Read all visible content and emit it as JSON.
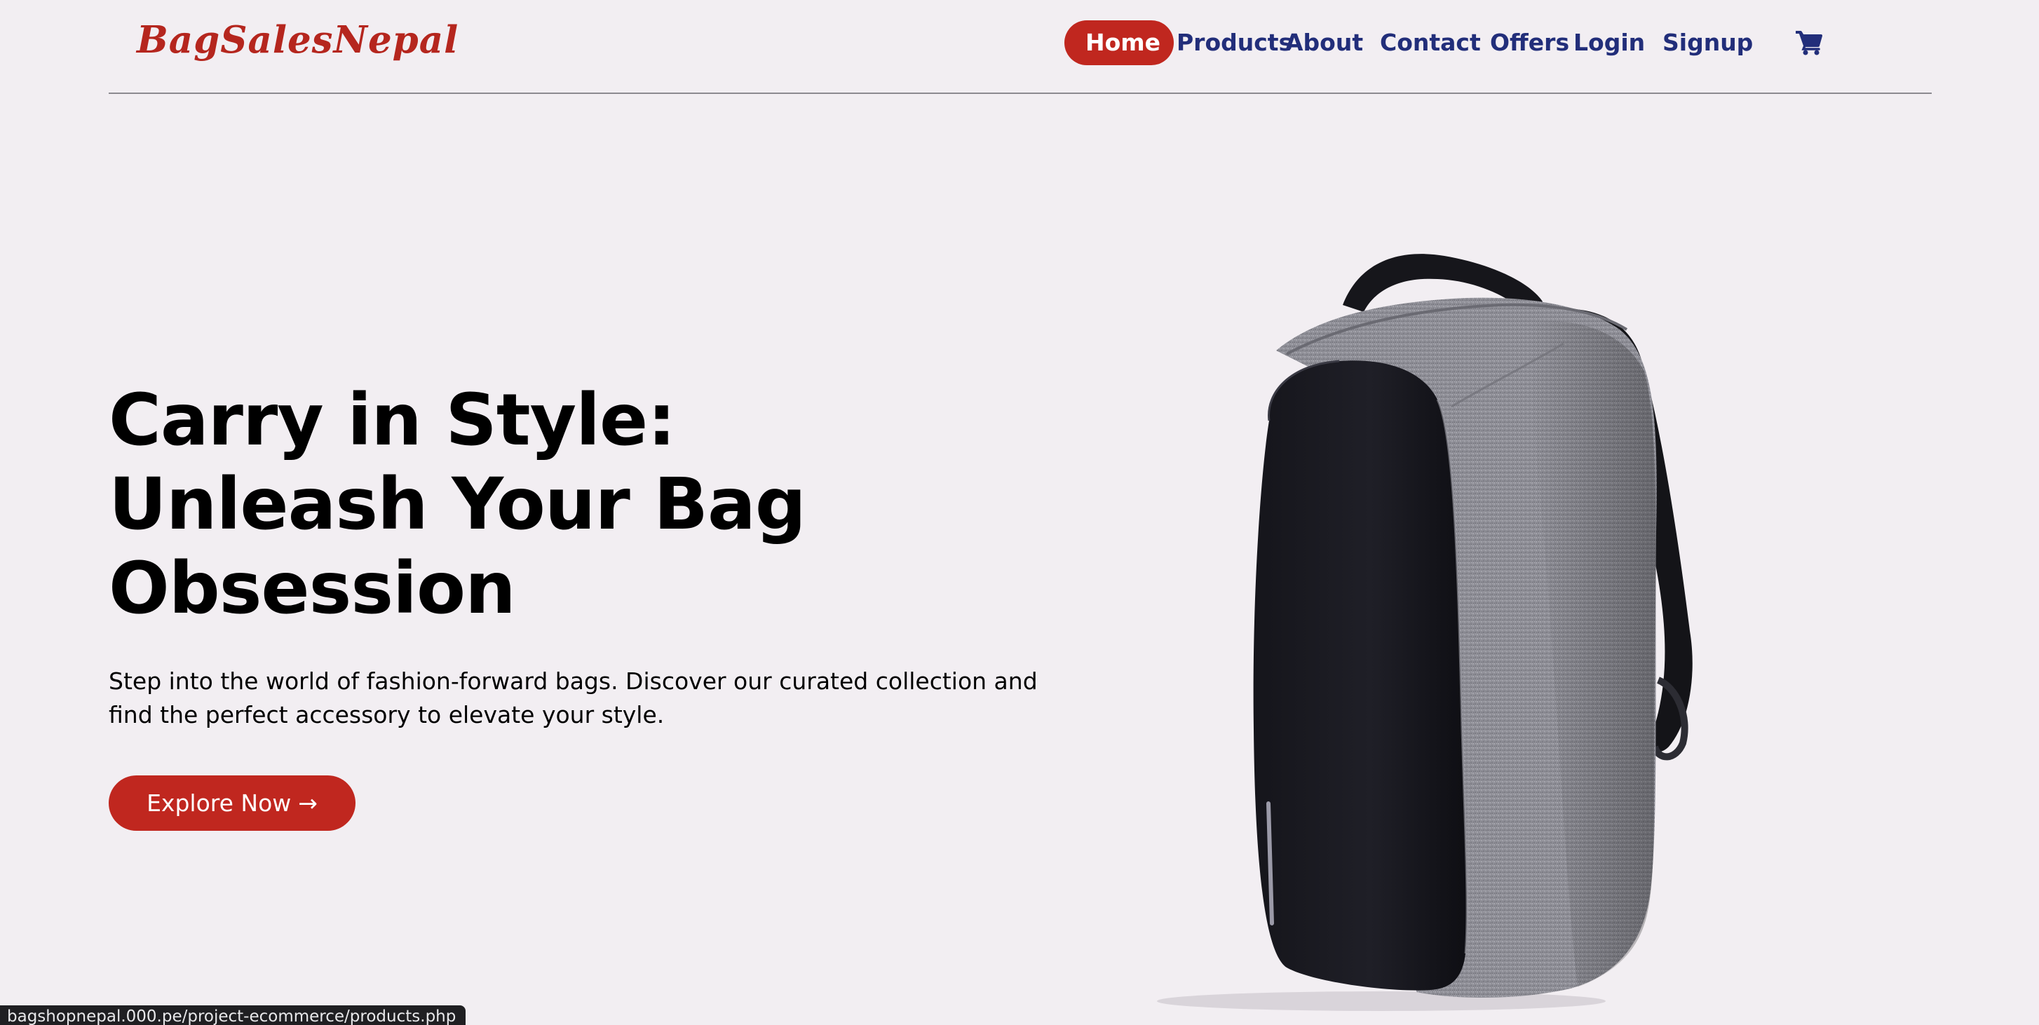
{
  "header": {
    "logo": "BagSalesNepal",
    "nav": {
      "home": "Home",
      "products": "Products",
      "about": "About",
      "contact": "Contact",
      "offers": "Offers",
      "login": "Login",
      "signup": "Signup"
    },
    "cart_icon": "shopping-cart-icon"
  },
  "hero": {
    "title_line1": "Carry in Style:",
    "title_line2": "Unleash Your Bag",
    "title_line3": "Obsession",
    "subtitle_line1": "Step into the world of fashion-forward bags. Discover our curated collection and",
    "subtitle_line2": "find the perfect accessory to elevate your style.",
    "cta_label": "Explore Now",
    "cta_arrow": "→",
    "image_icon": "backpack-image"
  },
  "status_bar": {
    "url": "bagshopnepal.000.pe/project-ecommerce/products.php"
  },
  "colors": {
    "background": "#f2eef2",
    "brand_red": "#c0271f",
    "logo_red": "#b5261e",
    "nav_blue": "#222e7a",
    "text": "#000000"
  }
}
